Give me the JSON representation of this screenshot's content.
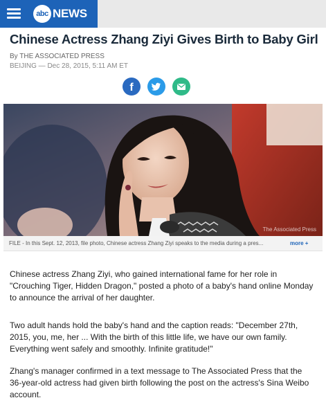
{
  "brand": {
    "logo_mark": "abc",
    "logo_text": "NEWS",
    "menu_icon": "hamburger-menu-icon",
    "accent_color": "#1d63b8"
  },
  "article": {
    "headline": "Chinese Actress Zhang Ziyi Gives Birth to Baby Girl",
    "byline": "By THE ASSOCIATED PRESS",
    "dateline": "BEIJING — Dec 28, 2015, 5:11 AM ET",
    "share": [
      {
        "name": "facebook-share-icon",
        "glyph": "f",
        "color": "#2a6ac0"
      },
      {
        "name": "twitter-share-icon",
        "color": "#2b9be8"
      },
      {
        "name": "email-share-icon",
        "color": "#2fba88"
      }
    ],
    "photo": {
      "watermark": "The Associated Press"
    },
    "caption": "FILE - In this Sept. 12, 2013, file photo, Chinese actress Zhang Ziyi speaks to the media during a pres...",
    "caption_more": "more +",
    "paragraphs": [
      "Chinese actress Zhang Ziyi, who gained international fame for her role in \"Crouching Tiger, Hidden Dragon,\" posted a photo of a baby's hand online Monday to announce the arrival of her daughter.",
      "Two adult hands hold the baby's hand and the caption reads: \"December 27th, 2015, you, me, her ... With the birth of this little life, we have our own family. Everything went safely and smoothly. Infinite gratitude!\"",
      "Zhang's manager confirmed in a text message to The Associated Press that the 36-year-old actress had given birth following the post on the actress's Sina Weibo account."
    ]
  }
}
